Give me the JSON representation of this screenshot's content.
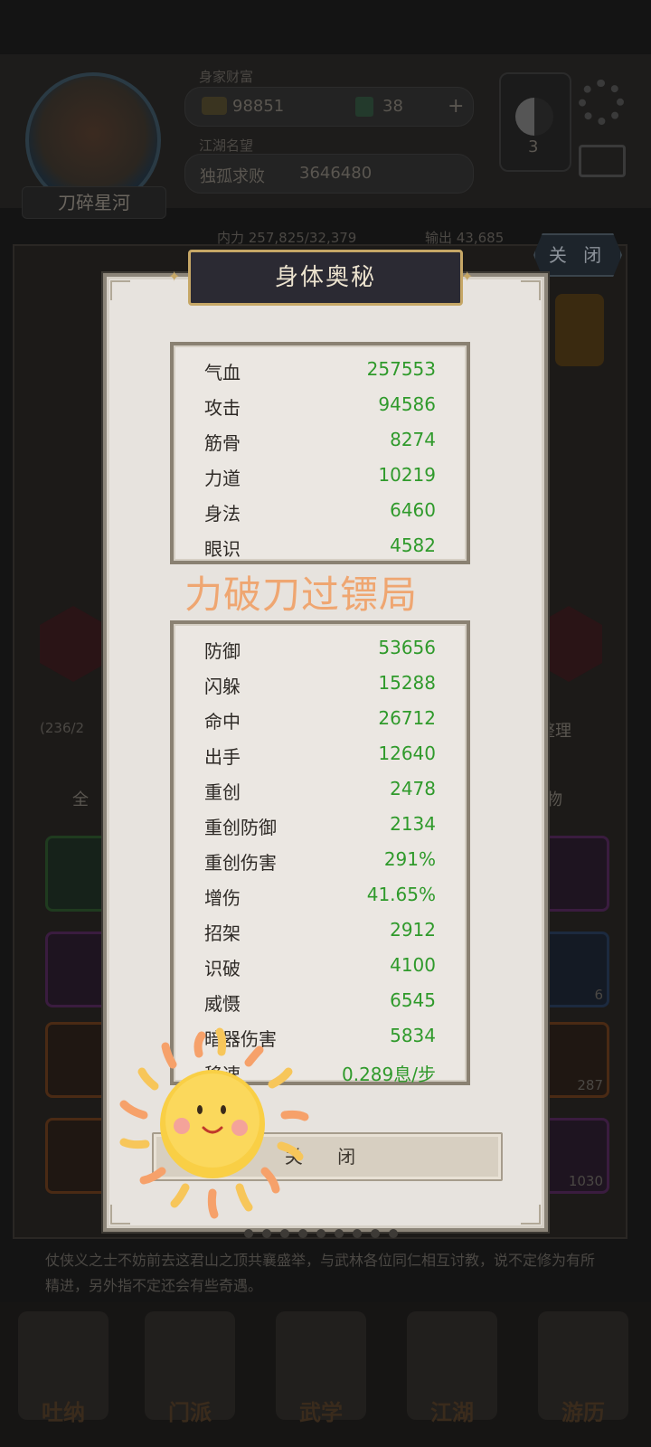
{
  "background": {
    "currency_gold": "98851",
    "currency_jade": "38",
    "header_label_1": "身家财富",
    "header_label_2": "江湖名望",
    "player_name": "刀碎星河",
    "title_name": "独孤求败",
    "title_score": "3646480",
    "level_badge": "3",
    "inner_power": "内力 257,825/32,379",
    "output_label": "输出 43,685",
    "bag_count": "(236/2",
    "sort_label": "整理",
    "filter_all": "全",
    "filter_item": "物",
    "slot_count_1": "6",
    "slot_count_2": "287",
    "slot_count_3": "1030",
    "story_text": "仗侠义之士不妨前去这君山之顶共襄盛举，与武林各位同仁相互讨教，说不定修为有所精进，另外指不定还会有些奇遇。",
    "nav_items": [
      "吐纳",
      "门派",
      "武学",
      "江湖",
      "游历"
    ]
  },
  "outer_close_label": "关 闭",
  "modal": {
    "title": "身体奥秘",
    "primary_stats": [
      {
        "label": "气血",
        "value": "257553"
      },
      {
        "label": "攻击",
        "value": "94586"
      },
      {
        "label": "筋骨",
        "value": "8274"
      },
      {
        "label": "力道",
        "value": "10219"
      },
      {
        "label": "身法",
        "value": "6460"
      },
      {
        "label": "眼识",
        "value": "4582"
      }
    ],
    "watermark": "力破刀过镖局",
    "secondary_stats": [
      {
        "label": "防御",
        "value": "53656"
      },
      {
        "label": "闪躲",
        "value": "15288"
      },
      {
        "label": "命中",
        "value": "26712"
      },
      {
        "label": "出手",
        "value": "12640"
      },
      {
        "label": "重创",
        "value": "2478"
      },
      {
        "label": "重创防御",
        "value": "2134"
      },
      {
        "label": "重创伤害",
        "value": "291%"
      },
      {
        "label": "增伤",
        "value": "41.65%"
      },
      {
        "label": "招架",
        "value": "2912"
      },
      {
        "label": "识破",
        "value": "4100"
      },
      {
        "label": "威慑",
        "value": "6545"
      },
      {
        "label": "暗器伤害",
        "value": "5834"
      },
      {
        "label": "移速",
        "value": "0.289息/步"
      }
    ],
    "close_label": "关 闭"
  },
  "colors": {
    "stat_value": "#2f9a2b",
    "stat_label": "#2e2a26",
    "title_bg": "#2b2a33",
    "title_border": "#c6a766",
    "watermark": "#f0a066"
  },
  "icons": {
    "sticker": "sun-sticker-icon",
    "settings": "gear-icon",
    "mail": "mail-icon",
    "taiji": "yin-yang-icon"
  }
}
